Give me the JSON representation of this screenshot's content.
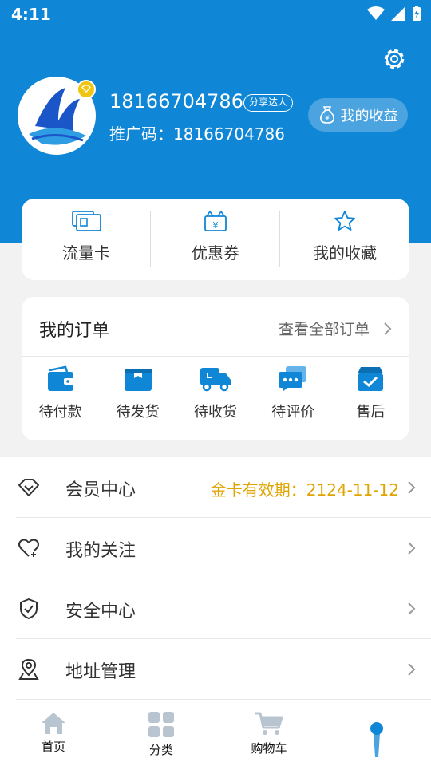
{
  "status": {
    "time": "4:11"
  },
  "profile": {
    "phone": "18166704786",
    "badge": "分享达人",
    "promo_label": "推广码：",
    "promo_code": "18166704786",
    "earnings_label": "我的收益"
  },
  "quick": [
    {
      "label": "流量卡",
      "icon": "sim-card-icon"
    },
    {
      "label": "优惠券",
      "icon": "coupon-icon"
    },
    {
      "label": "我的收藏",
      "icon": "star-icon"
    }
  ],
  "orders": {
    "title": "我的订单",
    "view_all": "查看全部订单",
    "items": [
      {
        "label": "待付款",
        "icon": "wallet-icon"
      },
      {
        "label": "待发货",
        "icon": "box-icon"
      },
      {
        "label": "待收货",
        "icon": "truck-icon"
      },
      {
        "label": "待评价",
        "icon": "chat-icon"
      },
      {
        "label": "售后",
        "icon": "after-sale-icon"
      }
    ]
  },
  "menu": [
    {
      "label": "会员中心",
      "value": "金卡有效期：2124-11-12",
      "icon": "diamond-icon"
    },
    {
      "label": "我的关注",
      "value": "",
      "icon": "heart-plus-icon"
    },
    {
      "label": "安全中心",
      "value": "",
      "icon": "shield-icon"
    },
    {
      "label": "地址管理",
      "value": "",
      "icon": "location-icon"
    }
  ],
  "tabs": [
    {
      "label": "首页",
      "icon": "home-icon"
    },
    {
      "label": "分类",
      "icon": "category-icon"
    },
    {
      "label": "购物车",
      "icon": "cart-icon"
    },
    {
      "label": "",
      "icon": "profile-icon"
    }
  ],
  "colors": {
    "primary": "#0f86d6",
    "accent_gold": "#e0a400",
    "icon_gray": "#b8c4cf"
  }
}
